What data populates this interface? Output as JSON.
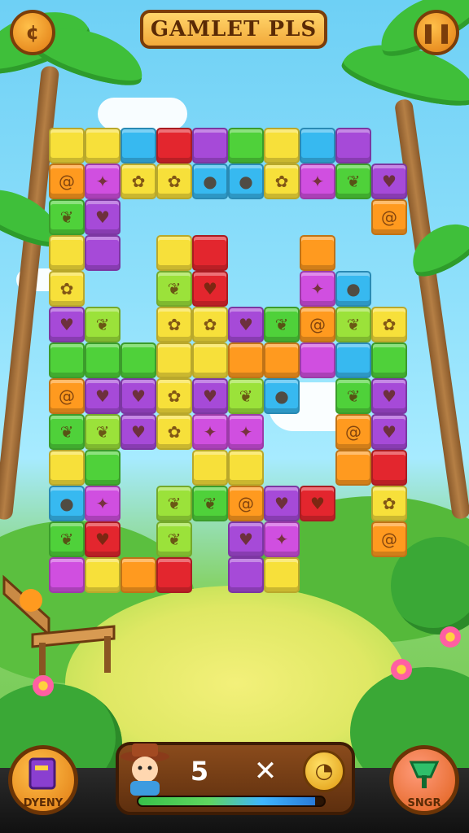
{
  "header": {
    "title": "GAMLET PLS",
    "left_icon": "coin-menu-icon",
    "right_icon": "pause-icon"
  },
  "board": {
    "icons": {
      "paw": "✿",
      "heart": "♥",
      "leaf": "❦",
      "spiral": "@",
      "star": "✦",
      "drop": "●",
      "bone": "✕",
      "fish": "◆"
    }
  },
  "hud": {
    "moves": "5",
    "multiplier_symbol": "✕",
    "coin_icon": "coin-icon",
    "progress_fraction": 0.95
  },
  "buttons": {
    "left_label": "DYENY",
    "right_label": "SNGR",
    "left_icon": "book-icon",
    "right_icon": "shovel-icon"
  },
  "colors": {
    "yellow": "#f7e03a",
    "purple": "#a64ad8",
    "green": "#4fd13a",
    "red": "#e3262e",
    "orange": "#ff9a1f",
    "blue": "#37b9f0",
    "magenta": "#d04fe0",
    "lime": "#9be23a",
    "wood": "#7a3d0a"
  }
}
